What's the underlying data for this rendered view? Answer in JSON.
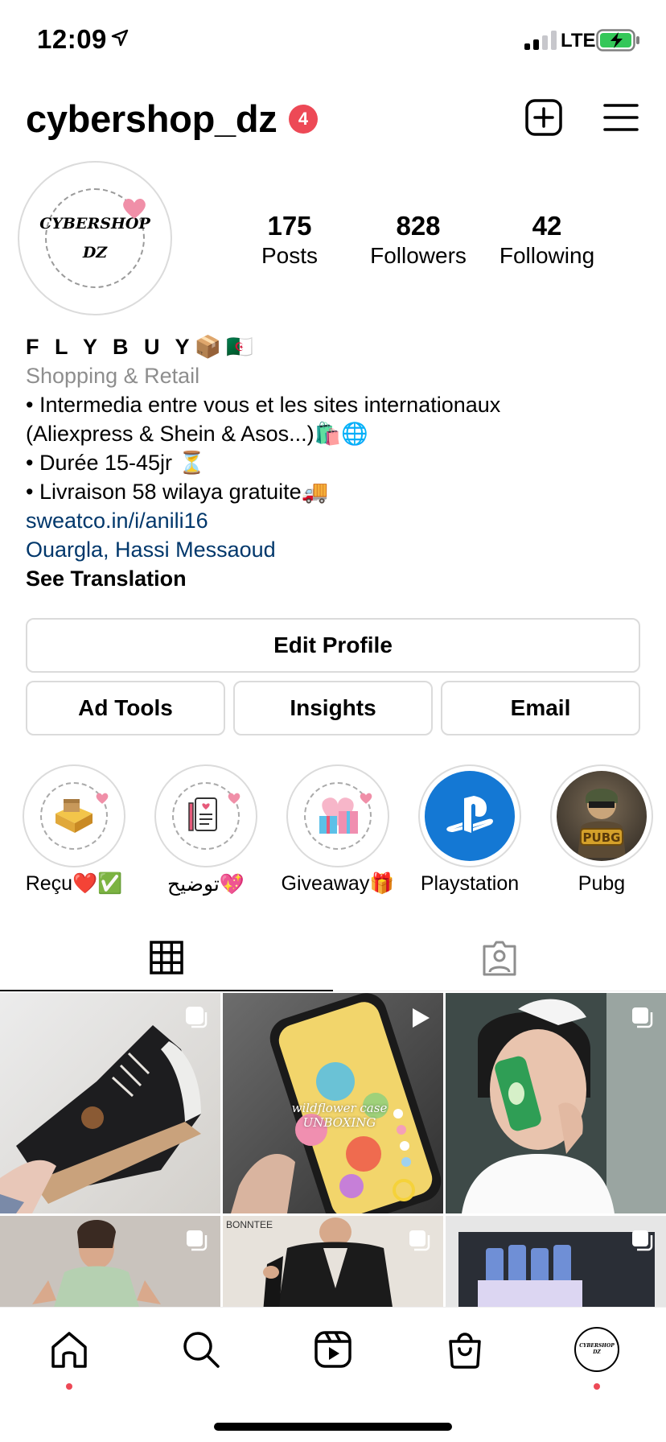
{
  "status": {
    "time": "12:09",
    "network": "LTE"
  },
  "header": {
    "username": "cybershop_dz",
    "notification_count": "4"
  },
  "profile": {
    "avatar_text_line1": "CYBERSHOP",
    "avatar_text_line2": "DZ",
    "stats": [
      {
        "value": "175",
        "label": "Posts"
      },
      {
        "value": "828",
        "label": "Followers"
      },
      {
        "value": "42",
        "label": "Following"
      }
    ]
  },
  "bio": {
    "name": "F L Y  B U Y📦🇩🇿",
    "category": "Shopping & Retail",
    "lines": [
      "• Intermedia entre vous et les sites internationaux",
      "(Aliexpress & Shein & Asos...)🛍️🌐",
      "• Durée 15-45jr ⏳",
      "• Livraison 58 wilaya gratuite🚚"
    ],
    "link": "sweatco.in/i/anili16",
    "location": "Ouargla, Hassi Messaoud",
    "see_translation": "See Translation"
  },
  "buttons": {
    "edit_profile": "Edit Profile",
    "ad_tools": "Ad Tools",
    "insights": "Insights",
    "email": "Email"
  },
  "highlights": [
    {
      "label": "Reçu❤️✅"
    },
    {
      "label": "توضيح💖"
    },
    {
      "label": "Giveaway🎁"
    },
    {
      "label": "Playstation"
    },
    {
      "label": "Pubg"
    }
  ],
  "grid_tiles": [
    {
      "caption": ""
    },
    {
      "caption": "wildflower case UNBOXING"
    },
    {
      "caption": ""
    },
    {
      "caption": ""
    },
    {
      "caption": "BONNTEE"
    },
    {
      "caption": ""
    }
  ],
  "colors": {
    "accent_red": "#ed4956",
    "link_blue": "#00376b",
    "secondary_text": "#8e8e8e",
    "border": "#dbdbdb"
  }
}
